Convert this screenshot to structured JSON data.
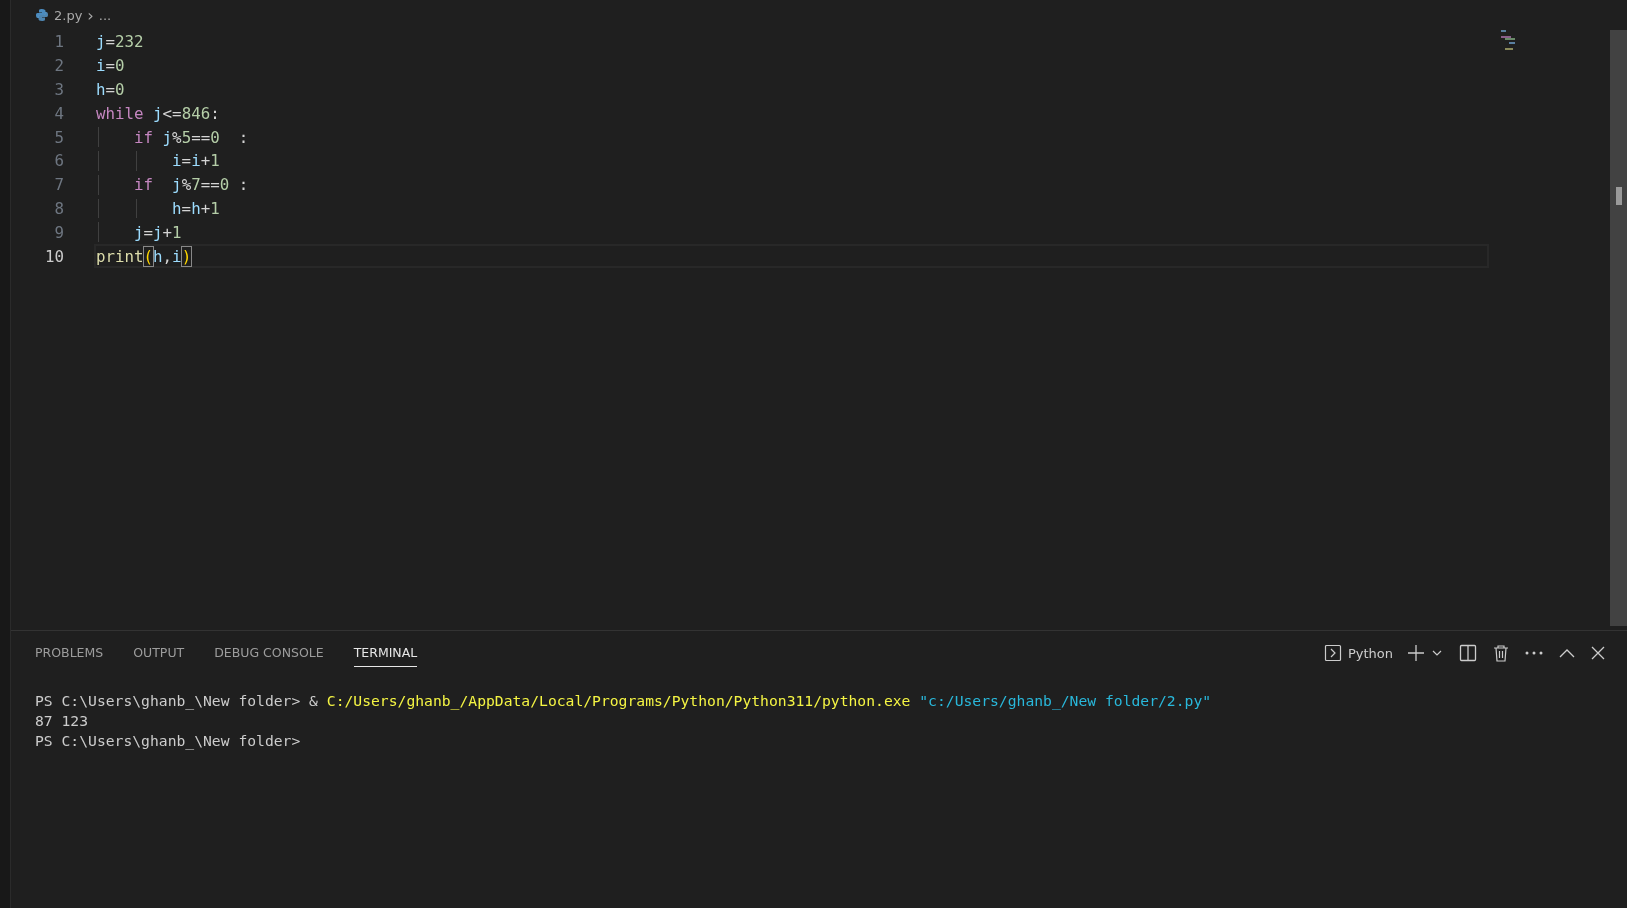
{
  "breadcrumb": {
    "file": "2.py",
    "separator": "›",
    "more": "..."
  },
  "editor": {
    "lines": [
      {
        "number": "1",
        "current": false,
        "tokens": [
          {
            "kind": "var",
            "text": "j"
          },
          {
            "kind": "op",
            "text": "="
          },
          {
            "kind": "num",
            "text": "232"
          }
        ]
      },
      {
        "number": "2",
        "current": false,
        "tokens": [
          {
            "kind": "var",
            "text": "i"
          },
          {
            "kind": "op",
            "text": "="
          },
          {
            "kind": "num",
            "text": "0"
          }
        ]
      },
      {
        "number": "3",
        "current": false,
        "tokens": [
          {
            "kind": "var",
            "text": "h"
          },
          {
            "kind": "op",
            "text": "="
          },
          {
            "kind": "num",
            "text": "0"
          }
        ]
      },
      {
        "number": "4",
        "current": false,
        "tokens": [
          {
            "kind": "keyword",
            "text": "while"
          },
          {
            "kind": "var",
            "text": " j"
          },
          {
            "kind": "op",
            "text": "<="
          },
          {
            "kind": "num",
            "text": "846"
          },
          {
            "kind": "op",
            "text": ":"
          }
        ]
      },
      {
        "number": "5",
        "current": false,
        "tokens": [
          {
            "kind": "keyword",
            "text": "    if"
          },
          {
            "kind": "var",
            "text": " j"
          },
          {
            "kind": "op",
            "text": "%"
          },
          {
            "kind": "num",
            "text": "5"
          },
          {
            "kind": "op",
            "text": "=="
          },
          {
            "kind": "num",
            "text": "0"
          },
          {
            "kind": "op",
            "text": "  :"
          }
        ]
      },
      {
        "number": "6",
        "current": false,
        "tokens": [
          {
            "kind": "var",
            "text": "        i"
          },
          {
            "kind": "op",
            "text": "="
          },
          {
            "kind": "var",
            "text": "i"
          },
          {
            "kind": "op",
            "text": "+"
          },
          {
            "kind": "num",
            "text": "1"
          }
        ]
      },
      {
        "number": "7",
        "current": false,
        "tokens": [
          {
            "kind": "keyword",
            "text": "    if"
          },
          {
            "kind": "var",
            "text": "  j"
          },
          {
            "kind": "op",
            "text": "%"
          },
          {
            "kind": "num",
            "text": "7"
          },
          {
            "kind": "op",
            "text": "=="
          },
          {
            "kind": "num",
            "text": "0"
          },
          {
            "kind": "op",
            "text": " :"
          }
        ]
      },
      {
        "number": "8",
        "current": false,
        "tokens": [
          {
            "kind": "var",
            "text": "        h"
          },
          {
            "kind": "op",
            "text": "="
          },
          {
            "kind": "var",
            "text": "h"
          },
          {
            "kind": "op",
            "text": "+"
          },
          {
            "kind": "num",
            "text": "1"
          }
        ]
      },
      {
        "number": "9",
        "current": false,
        "tokens": [
          {
            "kind": "var",
            "text": "    j"
          },
          {
            "kind": "op",
            "text": "="
          },
          {
            "kind": "var",
            "text": "j"
          },
          {
            "kind": "op",
            "text": "+"
          },
          {
            "kind": "num",
            "text": "1"
          }
        ]
      },
      {
        "number": "10",
        "current": true,
        "tokens": [
          {
            "kind": "func",
            "text": "print"
          },
          {
            "kind": "bracket",
            "text": "("
          },
          {
            "kind": "var",
            "text": "h"
          },
          {
            "kind": "op",
            "text": ","
          },
          {
            "kind": "var",
            "text": "i"
          },
          {
            "kind": "bracket",
            "text": ")"
          }
        ]
      }
    ]
  },
  "panel": {
    "tabs": [
      {
        "label": "PROBLEMS",
        "selected": false
      },
      {
        "label": "OUTPUT",
        "selected": false
      },
      {
        "label": "DEBUG CONSOLE",
        "selected": false
      },
      {
        "label": "TERMINAL",
        "selected": true
      }
    ],
    "terminal_name": "Python",
    "terminal": [
      [
        {
          "kind": "plain",
          "text": "PS C:\\Users\\ghanb_\\New folder> & "
        },
        {
          "kind": "command",
          "text": "C:/Users/ghanb_/AppData/Local/Programs/Python/Python311/python.exe"
        },
        {
          "kind": "string",
          "text": " \"c:/Users/ghanb_/New folder/2.py\""
        }
      ],
      [
        {
          "kind": "plain",
          "text": "87 123"
        }
      ],
      [
        {
          "kind": "plain",
          "text": "PS C:\\Users\\ghanb_\\New folder>"
        }
      ]
    ]
  }
}
